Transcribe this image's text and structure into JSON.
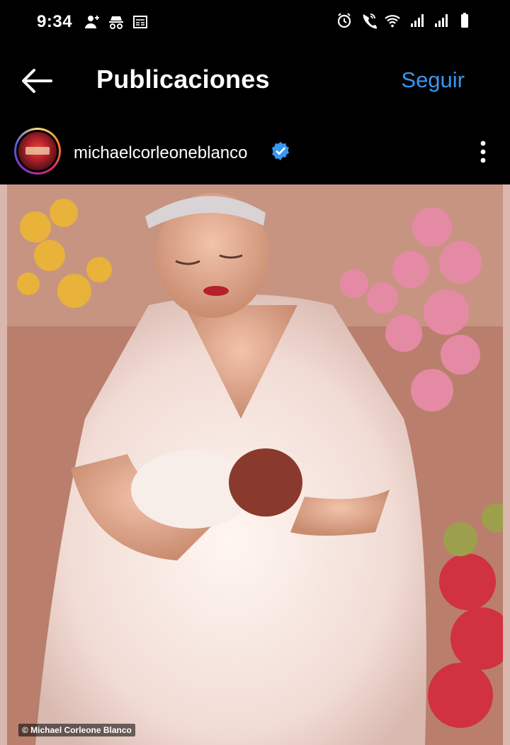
{
  "status_bar": {
    "time": "9:34",
    "left_icons": [
      "person-add-icon",
      "incognito-icon",
      "news-icon"
    ],
    "right_icons": [
      "alarm-icon",
      "wifi-calling-icon",
      "wifi-icon",
      "signal-icon",
      "signal-icon-2",
      "battery-icon"
    ]
  },
  "header": {
    "title": "Publicaciones",
    "follow_label": "Seguir",
    "back_icon": "back-arrow-icon"
  },
  "post": {
    "username": "michaelcorleoneblanco",
    "verified": true,
    "more_icon": "more-vertical-icon",
    "image_watermark": "© Michael Corleone Blanco"
  },
  "colors": {
    "background": "#000000",
    "accent": "#3897f0",
    "verified_badge": "#3897f0"
  }
}
